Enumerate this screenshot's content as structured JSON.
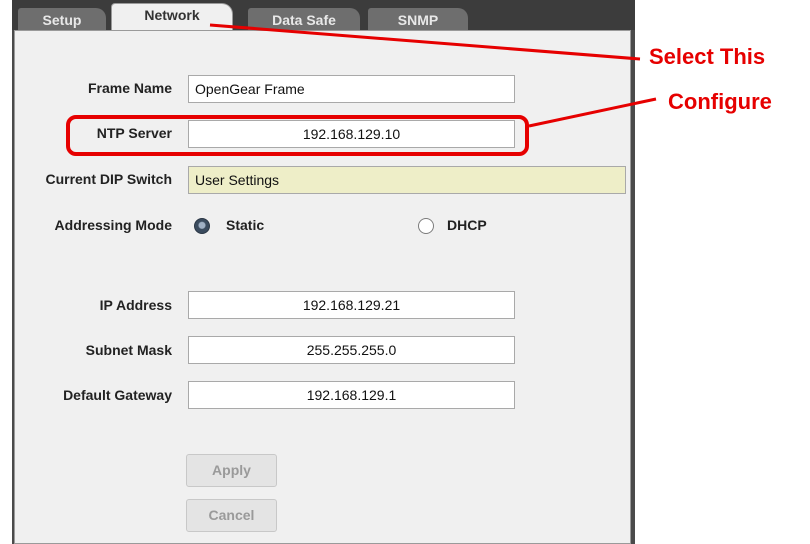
{
  "tabs": [
    {
      "label": "Setup",
      "active": false
    },
    {
      "label": "Network",
      "active": true
    },
    {
      "label": "Data Safe",
      "active": false
    },
    {
      "label": "SNMP",
      "active": false
    }
  ],
  "form": {
    "frame_name": {
      "label": "Frame Name",
      "value": "OpenGear Frame"
    },
    "ntp_server": {
      "label": "NTP Server",
      "value": "192.168.129.10"
    },
    "dip_switch": {
      "label": "Current DIP Switch",
      "value": "User Settings"
    },
    "addressing_mode": {
      "label": "Addressing Mode",
      "options": [
        "Static",
        "DHCP"
      ],
      "selected": "Static"
    },
    "ip_address": {
      "label": "IP Address",
      "value": "192.168.129.21"
    },
    "subnet_mask": {
      "label": "Subnet Mask",
      "value": "255.255.255.0"
    },
    "default_gateway": {
      "label": "Default Gateway",
      "value": "192.168.129.1"
    }
  },
  "buttons": {
    "apply": "Apply",
    "cancel": "Cancel"
  },
  "annotations": {
    "select_this": "Select This",
    "configure": "Configure",
    "color": "#e60000"
  }
}
